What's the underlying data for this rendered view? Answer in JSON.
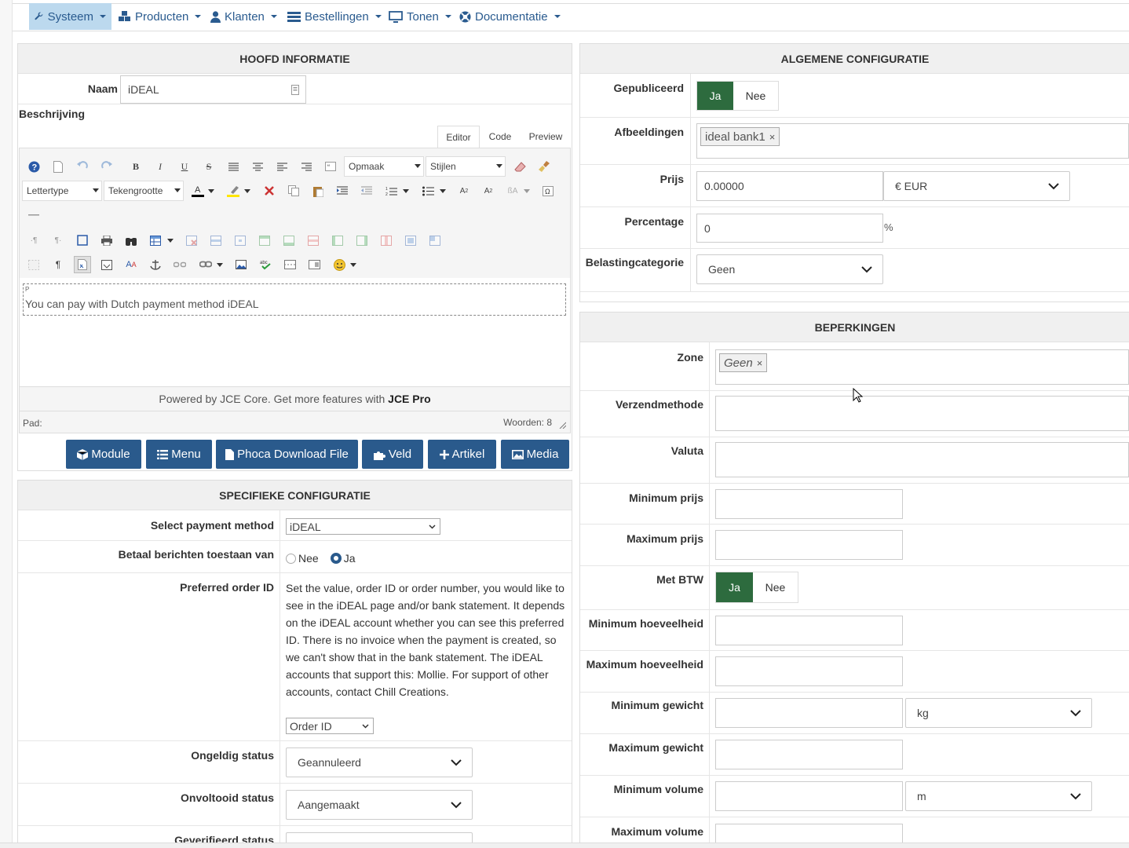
{
  "menu": {
    "items": [
      {
        "label": "Systeem",
        "icon": "wrench-icon"
      },
      {
        "label": "Producten",
        "icon": "cubes-icon"
      },
      {
        "label": "Klanten",
        "icon": "user-icon"
      },
      {
        "label": "Bestellingen",
        "icon": "list-icon"
      },
      {
        "label": "Tonen",
        "icon": "monitor-icon"
      },
      {
        "label": "Documentatie",
        "icon": "lifebuoy-icon"
      }
    ]
  },
  "hoofd": {
    "title": "HOOFD INFORMATIE",
    "naam_label": "Naam",
    "naam_value": "iDEAL",
    "beschrijving_label": "Beschrijving"
  },
  "editor": {
    "tabs": [
      "Editor",
      "Code",
      "Preview"
    ],
    "format_select": "Opmaak",
    "styles_select": "Stijlen",
    "font_select": "Lettertype",
    "size_select": "Tekengrootte",
    "tag": "P",
    "content": "You can pay with Dutch payment method iDEAL",
    "powered": "Powered by JCE Core. Get more features with ",
    "powered_bold": "JCE Pro",
    "path_label": "Pad:",
    "words": "Woorden: 8"
  },
  "buttons": [
    "Module",
    "Menu",
    "Phoca Download File",
    "Veld",
    "Artikel",
    "Media"
  ],
  "specifiek": {
    "title": "SPECIFIEKE CONFIGURATIE",
    "payment_label": "Select payment method",
    "payment_value": "iDEAL",
    "betaal_label": "Betaal berichten toestaan van",
    "radio_nee": "Nee",
    "radio_ja": "Ja",
    "order_label": "Preferred order ID",
    "order_text": "Set the value, order ID or order number, you would like to see in the iDEAL page and/or bank statement. It depends on the iDEAL account whether you can see this preferred ID. There is no invoice when the payment is created, so we can't show that in the bank statement. The iDEAL accounts that support this: Mollie. For support of other accounts, contact Chill Creations.",
    "order_value": "Order ID",
    "ongeldig_label": "Ongeldig status",
    "ongeldig_value": "Geannuleerd",
    "onvoltooid_label": "Onvoltooid status",
    "onvoltooid_value": "Aangemaakt",
    "geverifieerd_label": "Geverifieerd status"
  },
  "algemeen": {
    "title": "ALGEMENE CONFIGURATIE",
    "gepubliceerd_label": "Gepubliceerd",
    "ja": "Ja",
    "nee": "Nee",
    "afbeeldingen_label": "Afbeeldingen",
    "afbeelding_tag": "ideal bank1",
    "prijs_label": "Prijs",
    "prijs_value": "0.00000",
    "currency": "€ EUR",
    "percentage_label": "Percentage",
    "percentage_value": "0",
    "percent_sign": "%",
    "belasting_label": "Belastingcategorie",
    "belasting_value": "Geen"
  },
  "beperkingen": {
    "title": "BEPERKINGEN",
    "zone_label": "Zone",
    "zone_tag": "Geen",
    "verzend_label": "Verzendmethode",
    "valuta_label": "Valuta",
    "minprijs_label": "Minimum prijs",
    "maxprijs_label": "Maximum prijs",
    "btw_label": "Met BTW",
    "ja": "Ja",
    "nee": "Nee",
    "minhoev_label": "Minimum hoeveelheid",
    "maxhoev_label": "Maximum hoeveelheid",
    "mingew_label": "Minimum gewicht",
    "gew_unit": "kg",
    "maxgew_label": "Maximum gewicht",
    "minvol_label": "Minimum volume",
    "vol_unit": "m",
    "maxvol_label": "Maximum volume"
  }
}
